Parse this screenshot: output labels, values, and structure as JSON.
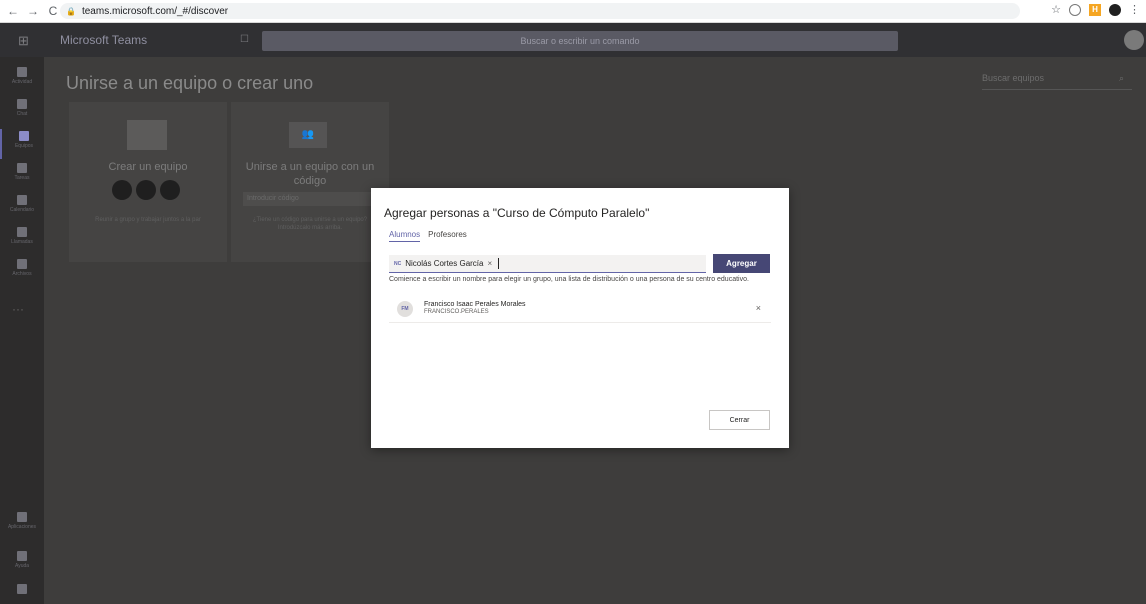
{
  "browser": {
    "back": "←",
    "forward": "→",
    "reload": "C",
    "url": "teams.microsoft.com/_#/discover",
    "star": "☆"
  },
  "topbar": {
    "brand": "Microsoft Teams",
    "search_placeholder": "Buscar o escribir un comando"
  },
  "rail": {
    "items": [
      {
        "label": "Actividad",
        "icon": "bell-icon"
      },
      {
        "label": "Chat",
        "icon": "chat-icon"
      },
      {
        "label": "Equipos",
        "icon": "teams-icon"
      },
      {
        "label": "Tareas",
        "icon": "assignments-icon"
      },
      {
        "label": "Calendario",
        "icon": "calendar-icon"
      },
      {
        "label": "Llamadas",
        "icon": "phone-icon"
      },
      {
        "label": "Archivos",
        "icon": "files-icon"
      }
    ],
    "more": "···",
    "bottom_items": [
      {
        "label": "Aplicaciones",
        "icon": "apps-icon"
      },
      {
        "label": "Ayuda",
        "icon": "help-icon"
      }
    ]
  },
  "main": {
    "title": "Unirse a un equipo o crear uno",
    "search_teams_placeholder": "Buscar equipos",
    "card_create": {
      "title": "Crear un equipo",
      "description": "Reunir a grupo y trabajar juntos a la par"
    },
    "card_join": {
      "title": "Unirse a un equipo con un código",
      "input_placeholder": "Introducir código",
      "description": "¿Tiene un código para unirse a un equipo? Introdúzcalo más arriba."
    }
  },
  "dialog": {
    "title": "Agregar personas a \"Curso de Cómputo Paralelo\"",
    "tabs": [
      "Alumnos",
      "Profesores"
    ],
    "active_tab": "Alumnos",
    "pill": {
      "initials": "NC",
      "name": "Nicolás Cortes García",
      "remove": "×"
    },
    "add_button": "Agregar",
    "hint": "Comience a escribir un nombre para elegir un grupo, una lista de distribución o una persona de su centro educativo.",
    "suggestion": {
      "initials": "FM",
      "name": "Francisco Isaac Perales Morales",
      "username": "FRANCISCO.PERALES",
      "remove": "×"
    },
    "close_button": "Cerrar"
  },
  "colors": {
    "accent": "#6264a7",
    "button_dark": "#464775"
  }
}
